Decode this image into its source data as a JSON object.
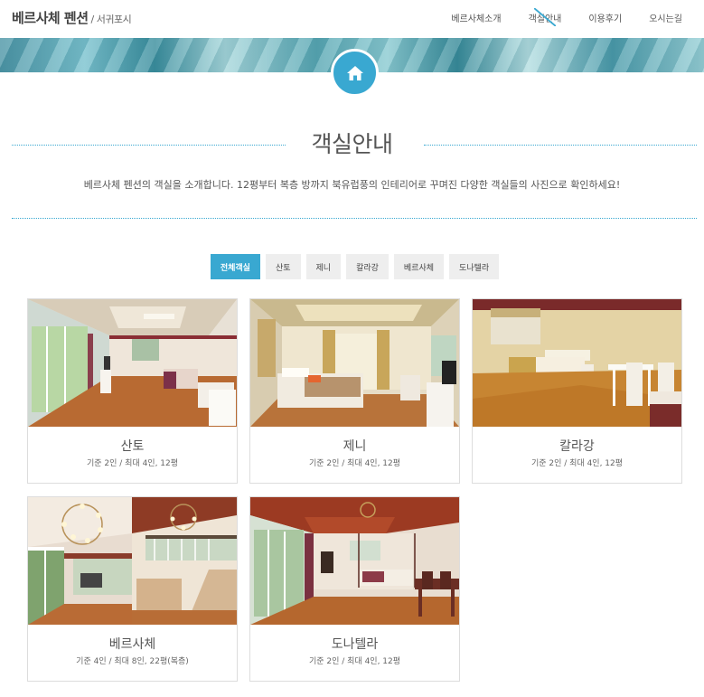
{
  "header": {
    "brand": "베르사체 펜션",
    "brand_sub": " / 서귀포시",
    "nav": [
      {
        "label": "베르사체소개"
      },
      {
        "label": "객실안내"
      },
      {
        "label": "이용후기"
      },
      {
        "label": "오시는길"
      }
    ]
  },
  "banner": {
    "home_icon": "home-icon"
  },
  "section": {
    "title": "객실안내",
    "description": "베르사체 펜션의 객실을 소개합니다. 12평부터 복층 방까지 북유럽풍의 인테리어로 꾸며진 다양한 객실들의 사진으로 확인하세요!"
  },
  "filters": [
    {
      "label": "전체객실",
      "active": true
    },
    {
      "label": "산토",
      "active": false
    },
    {
      "label": "제니",
      "active": false
    },
    {
      "label": "칼라강",
      "active": false
    },
    {
      "label": "베르사체",
      "active": false
    },
    {
      "label": "도나텔라",
      "active": false
    }
  ],
  "rooms": [
    {
      "name": "산토",
      "caption": "기준 2인 / 최대 4인, 12평"
    },
    {
      "name": "제니",
      "caption": "기준 2인 / 최대 4인, 12평"
    },
    {
      "name": "칼라강",
      "caption": "기준 2인 / 최대 4인, 12평"
    },
    {
      "name": "베르사체",
      "caption": "기준 4인 / 최대 8인, 22평(복층)"
    },
    {
      "name": "도나텔라",
      "caption": "기준 2인 / 최대 4인, 12평"
    }
  ],
  "colors": {
    "accent": "#39a8d1"
  }
}
